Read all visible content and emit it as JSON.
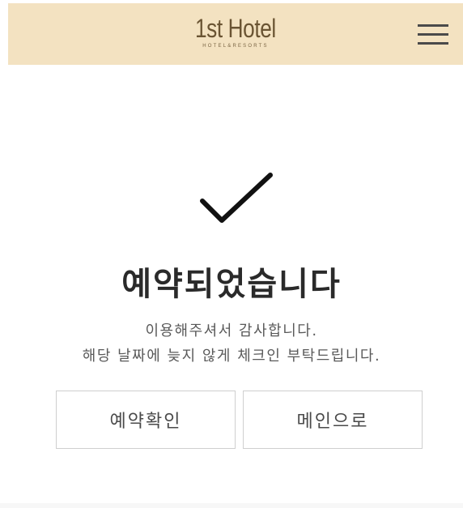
{
  "header": {
    "logo_main": "1st Hotel",
    "logo_sub": "HOTEL&RESORTS",
    "background": "#f3e2c1",
    "menu_icon": "hamburger-menu-icon"
  },
  "result": {
    "icon": "checkmark-icon",
    "title": "예약되었습니다",
    "message_line1": "이용해주셔서 감사합니다.",
    "message_line2": "해당 날짜에 늦지 않게 체크인 부탁드립니다."
  },
  "actions": {
    "confirm_label": "예약확인",
    "main_label": "메인으로"
  }
}
